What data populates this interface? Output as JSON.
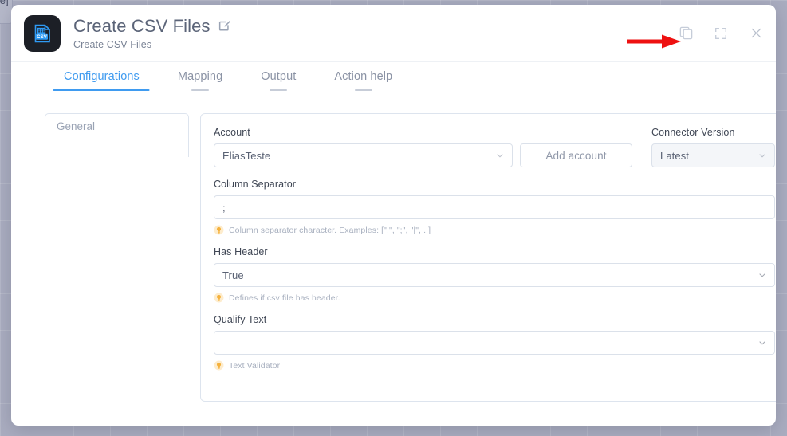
{
  "background": {
    "node_label": "e]"
  },
  "header": {
    "icon_name": "csv-file-icon",
    "title": "Create CSV Files",
    "subtitle": "Create CSV Files",
    "edit_icon": "edit-pencil-icon",
    "actions": [
      {
        "name": "duplicate-icon",
        "label": "Duplicate"
      },
      {
        "name": "fullscreen-icon",
        "label": "Fullscreen"
      },
      {
        "name": "close-icon",
        "label": "Close"
      }
    ],
    "annotation": {
      "name": "red-arrow-annotation",
      "color": "#ee1111"
    }
  },
  "tabs": [
    {
      "label": "Configurations",
      "active": true
    },
    {
      "label": "Mapping",
      "active": false
    },
    {
      "label": "Output",
      "active": false
    },
    {
      "label": "Action help",
      "active": false
    }
  ],
  "sidebar": {
    "items": [
      {
        "label": "General"
      }
    ]
  },
  "form": {
    "account": {
      "label": "Account",
      "value": "EliasTeste"
    },
    "add_account": {
      "label": "Add account"
    },
    "connector_version": {
      "label": "Connector Version",
      "value": "Latest"
    },
    "column_separator": {
      "label": "Column Separator",
      "value": ";",
      "hint": "Column separator character. Examples: [\",\", \";\", \"|\", . ]"
    },
    "has_header": {
      "label": "Has Header",
      "value": "True",
      "hint": "Defines if csv file has header."
    },
    "qualify_text": {
      "label": "Qualify Text",
      "value": "",
      "hint": "Text Validator"
    }
  },
  "colors": {
    "accent": "#3f9bf0",
    "annotation": "#ee1111",
    "canvas": "#aaadc0",
    "hint": "#a8b0bf"
  }
}
